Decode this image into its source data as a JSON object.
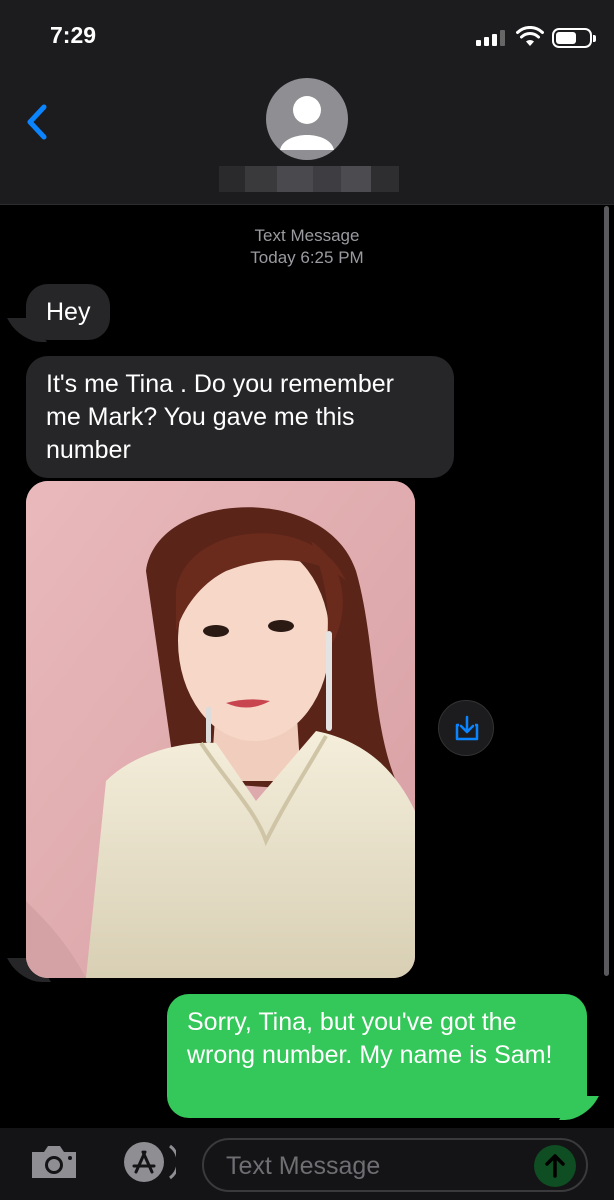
{
  "status_bar": {
    "time": "7:29"
  },
  "header": {
    "back_icon": "chevron-left-icon",
    "avatar_icon": "person-silhouette-icon",
    "contact_name_redacted": true
  },
  "thread": {
    "label": "Text Message",
    "timestamp": "Today 6:25 PM",
    "messages": [
      {
        "direction": "received",
        "text": "Hey"
      },
      {
        "direction": "received",
        "text": "It's me Tina . Do you remember me Mark? You gave me this number"
      },
      {
        "direction": "received",
        "type": "image",
        "icon": "save-to-photos-icon"
      },
      {
        "direction": "sent",
        "text": "Sorry, Tina, but you've got the wrong number. My name is Sam!"
      }
    ]
  },
  "composer": {
    "camera_icon": "camera-icon",
    "apps_icon": "app-store-icon",
    "placeholder": "Text Message",
    "send_icon": "send-arrow-icon"
  },
  "colors": {
    "sent_bubble": "#34c759",
    "received_bubble": "#262629",
    "accent_blue": "#0a84ff",
    "header_bg": "#1c1c1e"
  }
}
